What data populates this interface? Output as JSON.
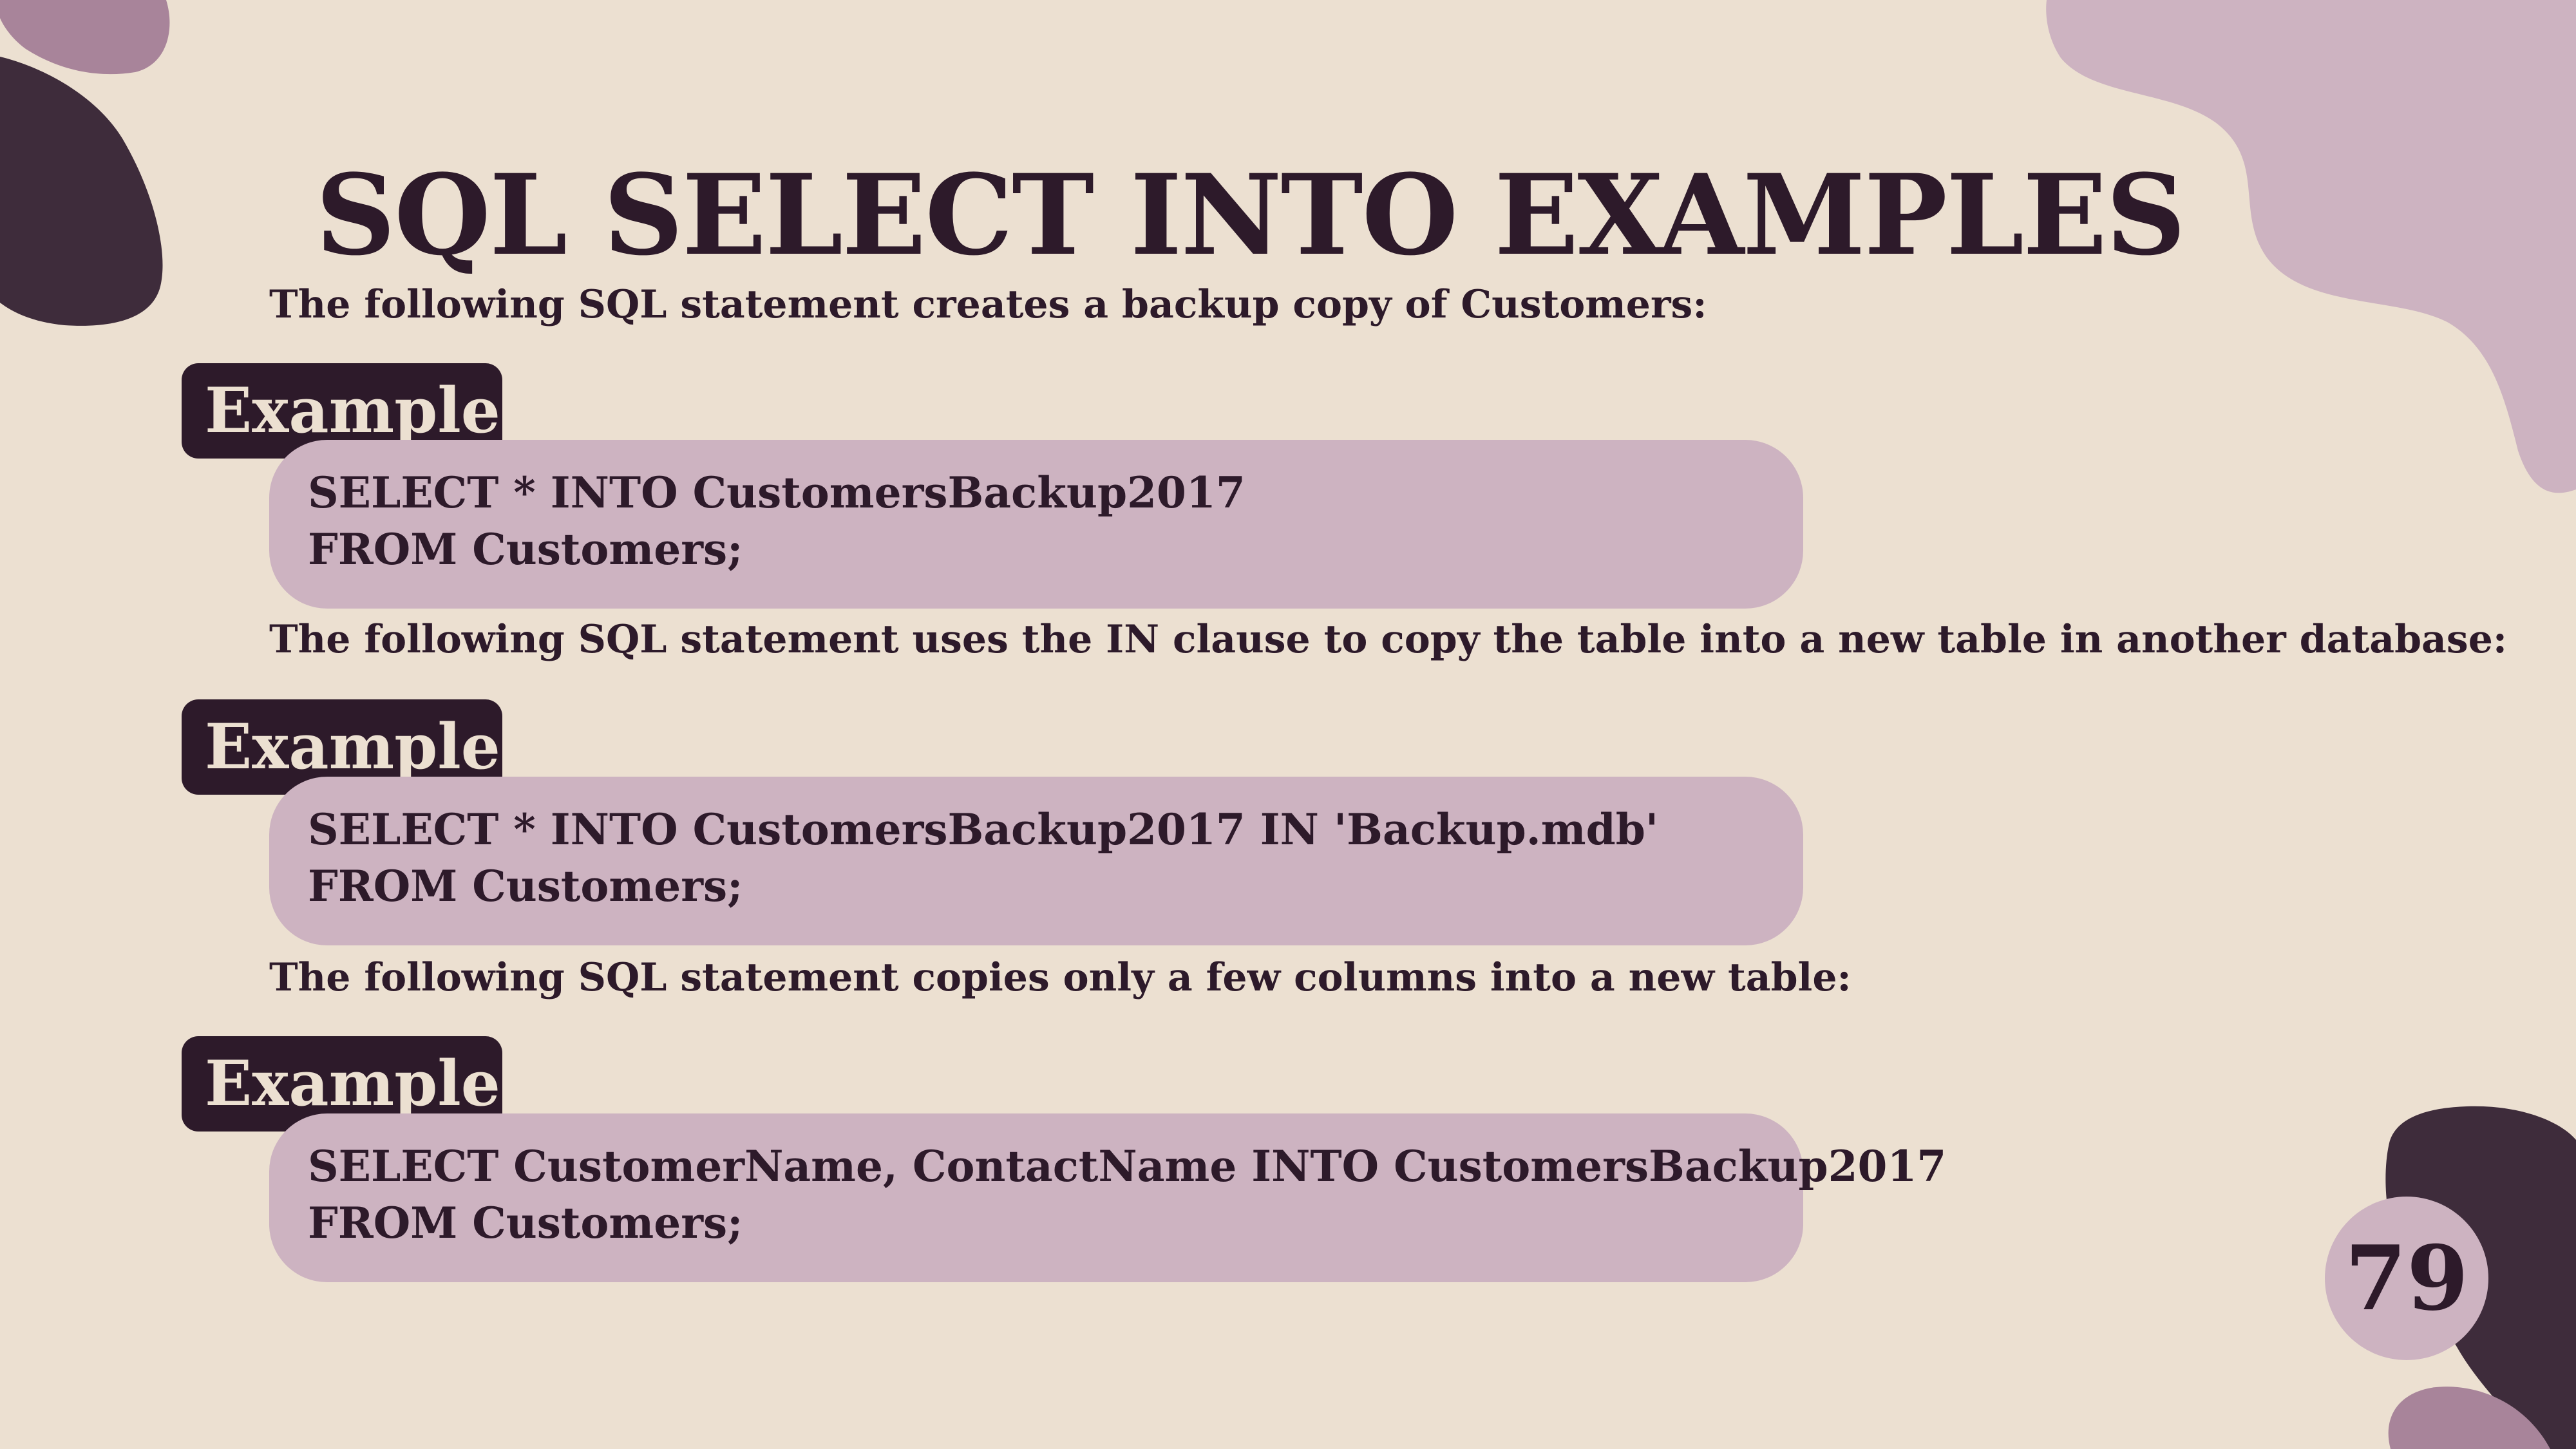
{
  "slide": {
    "title": "SQL SELECT INTO EXAMPLES",
    "page_number": "79"
  },
  "sections": [
    {
      "description": "The following SQL statement creates a backup copy of Customers:",
      "label": "Example:",
      "code": [
        "SELECT * INTO CustomersBackup2017",
        "FROM Customers;"
      ]
    },
    {
      "description": "The following SQL statement uses the IN clause to copy the table into a new table in another database:",
      "label": "Example:",
      "code": [
        "SELECT * INTO CustomersBackup2017 IN 'Backup.mdb'",
        "FROM Customers;"
      ]
    },
    {
      "description": "The following SQL statement copies only a few columns into a new table:",
      "label": "Example:",
      "code": [
        "SELECT CustomerName, ContactName INTO CustomersBackup2017",
        "FROM Customers;"
      ]
    }
  ],
  "colors": {
    "background": "#ECE0D1",
    "dark_plum": "#2D1A2A",
    "light_mauve": "#CDB3C1",
    "blob_dark": "#3E2C3B",
    "blob_mauve": "#A8849A"
  }
}
